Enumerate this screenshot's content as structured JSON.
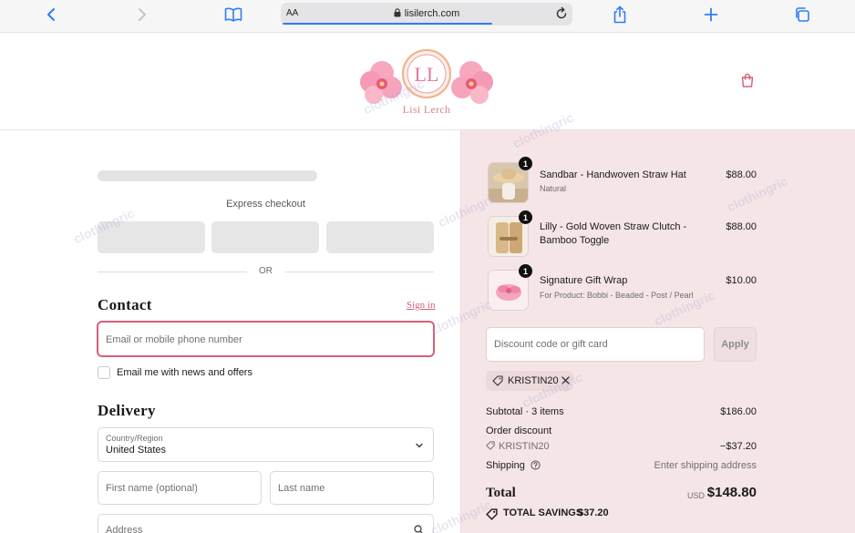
{
  "browser": {
    "text_size_label": "AA",
    "url": "lisilerch.com"
  },
  "header": {
    "brand_name": "Lisi Lerch",
    "monogram": "LL"
  },
  "express_checkout": {
    "label": "Express checkout",
    "divider_text": "OR"
  },
  "contact": {
    "heading": "Contact",
    "sign_in_label": "Sign in",
    "email_placeholder": "Email or mobile phone number",
    "newsletter_label": "Email me with news and offers"
  },
  "delivery": {
    "heading": "Delivery",
    "country_label": "Country/Region",
    "country_value": "United States",
    "first_name_placeholder": "First name (optional)",
    "last_name_placeholder": "Last name",
    "address_placeholder": "Address"
  },
  "order": {
    "items": [
      {
        "name": "Sandbar - Handwoven Straw Hat",
        "variant": "Natural",
        "price": "$88.00",
        "quantity": "1"
      },
      {
        "name": "Lilly - Gold Woven Straw Clutch - Bamboo Toggle",
        "variant": "",
        "price": "$88.00",
        "quantity": "1"
      },
      {
        "name": "Signature Gift Wrap",
        "variant": "For Product: Bobbi - Beaded - Post / Pearl",
        "price": "$10.00",
        "quantity": "1"
      }
    ],
    "discount_placeholder": "Discount code or gift card",
    "apply_label": "Apply",
    "applied_code": "KRISTIN20",
    "subtotal_label": "Subtotal · 3 items",
    "subtotal_value": "$186.00",
    "order_discount_label": "Order discount",
    "order_discount_code": "KRISTIN20",
    "order_discount_value": "−$37.20",
    "shipping_label": "Shipping",
    "shipping_value": "Enter shipping address",
    "total_label": "Total",
    "total_currency": "USD",
    "total_value": "$148.80",
    "savings_label": "TOTAL SAVINGS",
    "savings_value": "$37.20"
  },
  "watermark": "clothingric",
  "colors": {
    "accent": "#d2617a",
    "summary_bg": "#f6e5e7",
    "link_blue": "#2f7df6"
  }
}
